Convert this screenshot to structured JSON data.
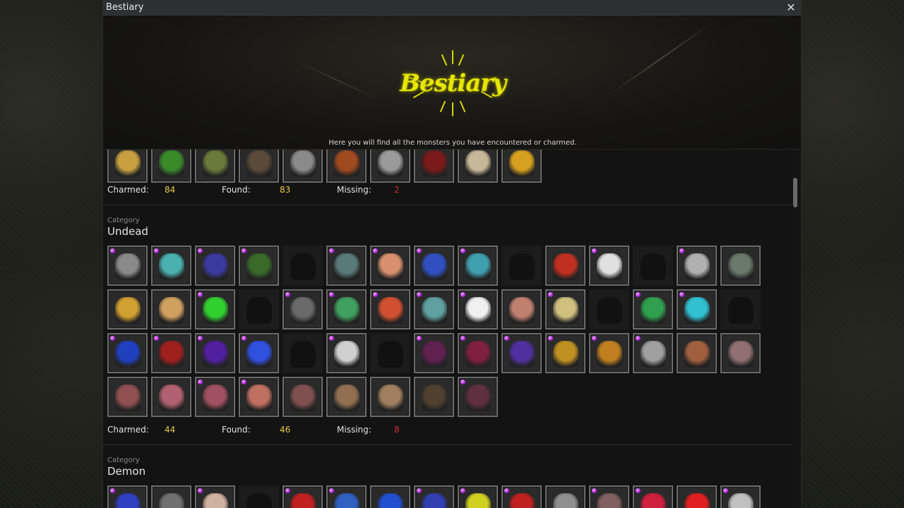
{
  "window": {
    "title": "Bestiary"
  },
  "header": {
    "logo_text": "Bestiary",
    "subtitle": "Here you will find all the monsters you have encountered or charmed."
  },
  "sections": [
    {
      "category_label": "",
      "category_name": "",
      "stats": {
        "charmed_label": "Charmed:",
        "charmed": "84",
        "found_label": "Found:",
        "found": "83",
        "missing_label": "Missing:",
        "missing": "2"
      },
      "tiles": [
        {
          "known": true,
          "charmed": false,
          "color": "#c8a040"
        },
        {
          "known": true,
          "charmed": false,
          "color": "#3a8a2a"
        },
        {
          "known": true,
          "charmed": false,
          "color": "#6a7a3a"
        },
        {
          "known": true,
          "charmed": false,
          "color": "#5a4a3a"
        },
        {
          "known": true,
          "charmed": false,
          "color": "#8a8a8a"
        },
        {
          "known": true,
          "charmed": false,
          "color": "#a04a20"
        },
        {
          "known": true,
          "charmed": false,
          "color": "#9a9a9a"
        },
        {
          "known": true,
          "charmed": false,
          "color": "#7a1a1a"
        },
        {
          "known": true,
          "charmed": false,
          "color": "#c8b89a"
        },
        {
          "known": true,
          "charmed": false,
          "color": "#d8a020"
        }
      ]
    },
    {
      "category_label": "Category",
      "category_name": "Undead",
      "stats": {
        "charmed_label": "Charmed:",
        "charmed": "44",
        "found_label": "Found:",
        "found": "46",
        "missing_label": "Missing:",
        "missing": "8"
      },
      "tiles": [
        {
          "known": true,
          "charmed": true,
          "color": "#8a8a8a"
        },
        {
          "known": true,
          "charmed": true,
          "color": "#4ab0b0"
        },
        {
          "known": true,
          "charmed": true,
          "color": "#3a3aa0"
        },
        {
          "known": true,
          "charmed": true,
          "color": "#3a6a2a"
        },
        {
          "known": false,
          "charmed": false,
          "color": "#101010"
        },
        {
          "known": true,
          "charmed": true,
          "color": "#5a7a7a"
        },
        {
          "known": true,
          "charmed": true,
          "color": "#d89070"
        },
        {
          "known": true,
          "charmed": true,
          "color": "#3050c0"
        },
        {
          "known": true,
          "charmed": true,
          "color": "#40a0b0"
        },
        {
          "known": false,
          "charmed": false,
          "color": "#101010"
        },
        {
          "known": true,
          "charmed": false,
          "color": "#c03020"
        },
        {
          "known": true,
          "charmed": true,
          "color": "#e0e0e0"
        },
        {
          "known": false,
          "charmed": false,
          "color": "#101010"
        },
        {
          "known": true,
          "charmed": true,
          "color": "#b0b0b0"
        },
        {
          "known": true,
          "charmed": false,
          "color": "#6a7a6a"
        },
        {
          "known": true,
          "charmed": false,
          "color": "#d0a030"
        },
        {
          "known": true,
          "charmed": false,
          "color": "#d0a060"
        },
        {
          "known": true,
          "charmed": true,
          "color": "#30d030"
        },
        {
          "known": false,
          "charmed": false,
          "color": "#101010"
        },
        {
          "known": true,
          "charmed": true,
          "color": "#6a6a6a"
        },
        {
          "known": true,
          "charmed": true,
          "color": "#40a060"
        },
        {
          "known": true,
          "charmed": true,
          "color": "#d05030"
        },
        {
          "known": true,
          "charmed": true,
          "color": "#60a0a0"
        },
        {
          "known": true,
          "charmed": true,
          "color": "#f0f0f0"
        },
        {
          "known": true,
          "charmed": false,
          "color": "#c08070"
        },
        {
          "known": true,
          "charmed": true,
          "color": "#d0c080"
        },
        {
          "known": false,
          "charmed": false,
          "color": "#101010"
        },
        {
          "known": true,
          "charmed": true,
          "color": "#30a050"
        },
        {
          "known": true,
          "charmed": true,
          "color": "#30c0d0"
        },
        {
          "known": false,
          "charmed": false,
          "color": "#101010"
        },
        {
          "known": true,
          "charmed": true,
          "color": "#2040c0"
        },
        {
          "known": true,
          "charmed": true,
          "color": "#a02020"
        },
        {
          "known": true,
          "charmed": true,
          "color": "#5020a0"
        },
        {
          "known": true,
          "charmed": true,
          "color": "#3050e0"
        },
        {
          "known": false,
          "charmed": false,
          "color": "#101010"
        },
        {
          "known": true,
          "charmed": true,
          "color": "#d0d0d0"
        },
        {
          "known": false,
          "charmed": false,
          "color": "#101010"
        },
        {
          "known": true,
          "charmed": true,
          "color": "#602050"
        },
        {
          "known": true,
          "charmed": true,
          "color": "#802040"
        },
        {
          "known": true,
          "charmed": true,
          "color": "#5030a0"
        },
        {
          "known": true,
          "charmed": true,
          "color": "#c09020"
        },
        {
          "known": true,
          "charmed": true,
          "color": "#c08020"
        },
        {
          "known": true,
          "charmed": true,
          "color": "#a0a0a0"
        },
        {
          "known": true,
          "charmed": false,
          "color": "#a06040"
        },
        {
          "known": true,
          "charmed": false,
          "color": "#907070"
        },
        {
          "known": true,
          "charmed": false,
          "color": "#905050"
        },
        {
          "known": true,
          "charmed": false,
          "color": "#b06070"
        },
        {
          "known": true,
          "charmed": true,
          "color": "#a05060"
        },
        {
          "known": true,
          "charmed": true,
          "color": "#c07060"
        },
        {
          "known": true,
          "charmed": false,
          "color": "#805050"
        },
        {
          "known": true,
          "charmed": false,
          "color": "#907050"
        },
        {
          "known": true,
          "charmed": false,
          "color": "#a08060"
        },
        {
          "known": true,
          "charmed": false,
          "color": "#504030"
        },
        {
          "known": true,
          "charmed": true,
          "color": "#603040"
        }
      ]
    },
    {
      "category_label": "Category",
      "category_name": "Demon",
      "tiles": [
        {
          "known": true,
          "charmed": true,
          "color": "#3040c0"
        },
        {
          "known": true,
          "charmed": false,
          "color": "#707070"
        },
        {
          "known": true,
          "charmed": true,
          "color": "#d0b0a0"
        },
        {
          "known": false,
          "charmed": false,
          "color": "#101010"
        },
        {
          "known": true,
          "charmed": true,
          "color": "#c02020"
        },
        {
          "known": true,
          "charmed": true,
          "color": "#3060c0"
        },
        {
          "known": true,
          "charmed": false,
          "color": "#2050d0"
        },
        {
          "known": true,
          "charmed": true,
          "color": "#3040b0"
        },
        {
          "known": true,
          "charmed": true,
          "color": "#d0d020"
        },
        {
          "known": true,
          "charmed": true,
          "color": "#c02020"
        },
        {
          "known": true,
          "charmed": false,
          "color": "#909090"
        },
        {
          "known": true,
          "charmed": true,
          "color": "#806060"
        },
        {
          "known": true,
          "charmed": true,
          "color": "#d02040"
        },
        {
          "known": true,
          "charmed": false,
          "color": "#e02020"
        },
        {
          "known": true,
          "charmed": true,
          "color": "#c0c0c0"
        }
      ]
    }
  ]
}
